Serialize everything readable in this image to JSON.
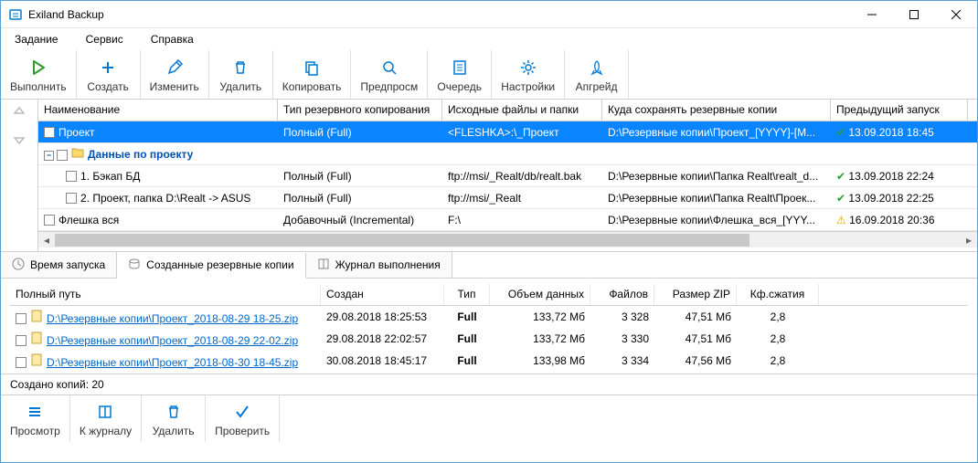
{
  "title": "Exiland Backup",
  "menu": {
    "task": "Задание",
    "service": "Сервис",
    "help": "Справка"
  },
  "toolbar": {
    "run": "Выполнить",
    "create": "Создать",
    "edit": "Изменить",
    "delete": "Удалить",
    "copy": "Копировать",
    "preview": "Предпросм",
    "queue": "Очередь",
    "settings": "Настройки",
    "upgrade": "Апгрейд"
  },
  "grid": {
    "h": {
      "name": "Наименование",
      "type": "Тип резервного копирования",
      "src": "Исходные файлы и папки",
      "dst": "Куда сохранять резервные копии",
      "last": "Предыдущий запуск"
    },
    "rows": [
      {
        "name": "Проект",
        "type": "Полный (Full)",
        "src": "<FLESHKA>:\\_Проект",
        "dst": "D:\\Резервные копии\\Проект_[YYYY]-[M...",
        "last": "13.09.2018  18:45",
        "status": "ok",
        "indent": 0,
        "selected": true,
        "expander": ""
      },
      {
        "name": "Данные по проекту",
        "type": "",
        "src": "",
        "dst": "",
        "last": "",
        "status": "",
        "indent": 0,
        "bold": true,
        "folder": true,
        "expander": "−"
      },
      {
        "name": "1. Бэкап БД",
        "type": "Полный (Full)",
        "src": "ftp://msi/_Realt/db/realt.bak",
        "dst": "D:\\Резервные копии\\Папка Realt\\realt_d...",
        "last": "13.09.2018  22:24",
        "status": "ok",
        "indent": 1,
        "expander": ""
      },
      {
        "name": "2. Проект, папка D:\\Realt -> ASUS",
        "type": "Полный (Full)",
        "src": "ftp://msi/_Realt",
        "dst": "D:\\Резервные копии\\Папка Realt\\Проек...",
        "last": "13.09.2018  22:25",
        "status": "ok",
        "indent": 1,
        "expander": ""
      },
      {
        "name": "Флешка вся",
        "type": "Добавочный (Incremental)",
        "src": "F:\\",
        "dst": "D:\\Резервные копии\\Флешка_вся_[YYY...",
        "last": "16.09.2018  20:36",
        "status": "warn",
        "indent": 0,
        "expander": ""
      }
    ]
  },
  "tabs": {
    "t1": "Время запуска",
    "t2": "Созданные резервные копии",
    "t3": "Журнал выполнения"
  },
  "copies": {
    "h": {
      "path": "Полный путь",
      "created": "Создан",
      "type": "Тип",
      "vol": "Объем данных",
      "files": "Файлов",
      "zip": "Размер ZIP",
      "ratio": "Кф.сжатия"
    },
    "rows": [
      {
        "path": "D:\\Резервные копии\\Проект_2018-08-29 18-25.zip",
        "created": "29.08.2018  18:25:53",
        "type": "Full",
        "vol": "133,72 Мб",
        "files": "3 328",
        "zip": "47,51 Мб",
        "ratio": "2,8"
      },
      {
        "path": "D:\\Резервные копии\\Проект_2018-08-29 22-02.zip",
        "created": "29.08.2018  22:02:57",
        "type": "Full",
        "vol": "133,72 Мб",
        "files": "3 330",
        "zip": "47,51 Мб",
        "ratio": "2,8"
      },
      {
        "path": "D:\\Резервные копии\\Проект_2018-08-30 18-45.zip",
        "created": "30.08.2018  18:45:17",
        "type": "Full",
        "vol": "133,98 Мб",
        "files": "3 334",
        "zip": "47,56 Мб",
        "ratio": "2,8"
      }
    ]
  },
  "status": "Создано копий: 20",
  "bottom": {
    "view": "Просмотр",
    "log": "К журналу",
    "delete": "Удалить",
    "check": "Проверить"
  }
}
